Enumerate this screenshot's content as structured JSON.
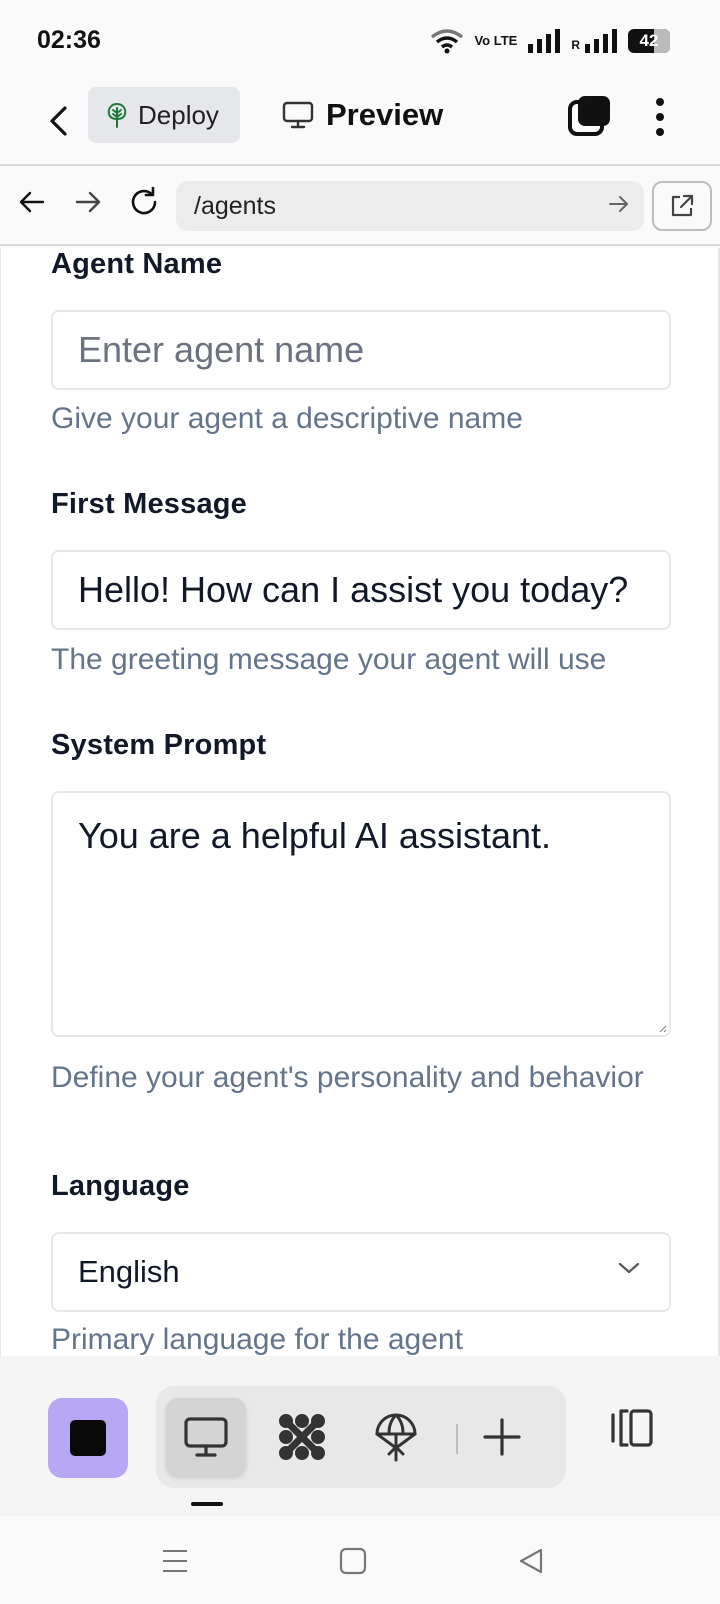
{
  "status_bar": {
    "time": "02:36",
    "lte_label": "Vo LTE",
    "roaming_label": "R",
    "battery": "42"
  },
  "app_bar": {
    "deploy_label": "Deploy",
    "preview_label": "Preview"
  },
  "browser": {
    "url": "/agents"
  },
  "form": {
    "agent_name": {
      "label": "Agent Name",
      "placeholder": "Enter agent name",
      "value": "",
      "help": "Give your agent a descriptive name"
    },
    "first_message": {
      "label": "First Message",
      "value": "Hello! How can I assist you today?",
      "help": "The greeting message your agent will use"
    },
    "system_prompt": {
      "label": "System Prompt",
      "value": "You are a helpful AI assistant.",
      "help": "Define your agent's personality and behavior"
    },
    "language": {
      "label": "Language",
      "selected": "English",
      "help": "Primary language for the agent"
    }
  },
  "colors": {
    "accent_stop": "#b8a7f5",
    "help_text": "#64748b",
    "deploy_icon": "#1f7a3a"
  },
  "icons": {
    "back": "chevron-left-icon",
    "deploy": "tree-icon",
    "preview": "monitor-icon",
    "tabs": "stacked-squares-icon",
    "more": "kebab-menu-icon",
    "nav_back": "arrow-left-icon",
    "nav_forward": "arrow-right-icon",
    "reload": "refresh-icon",
    "go": "arrow-right-icon",
    "open_external": "external-link-icon",
    "stop": "stop-icon",
    "desktop": "monitor-icon",
    "integrations": "network-icon",
    "deploy_tool": "parachute-icon",
    "add": "plus-icon",
    "panel": "panel-toggle-icon"
  }
}
